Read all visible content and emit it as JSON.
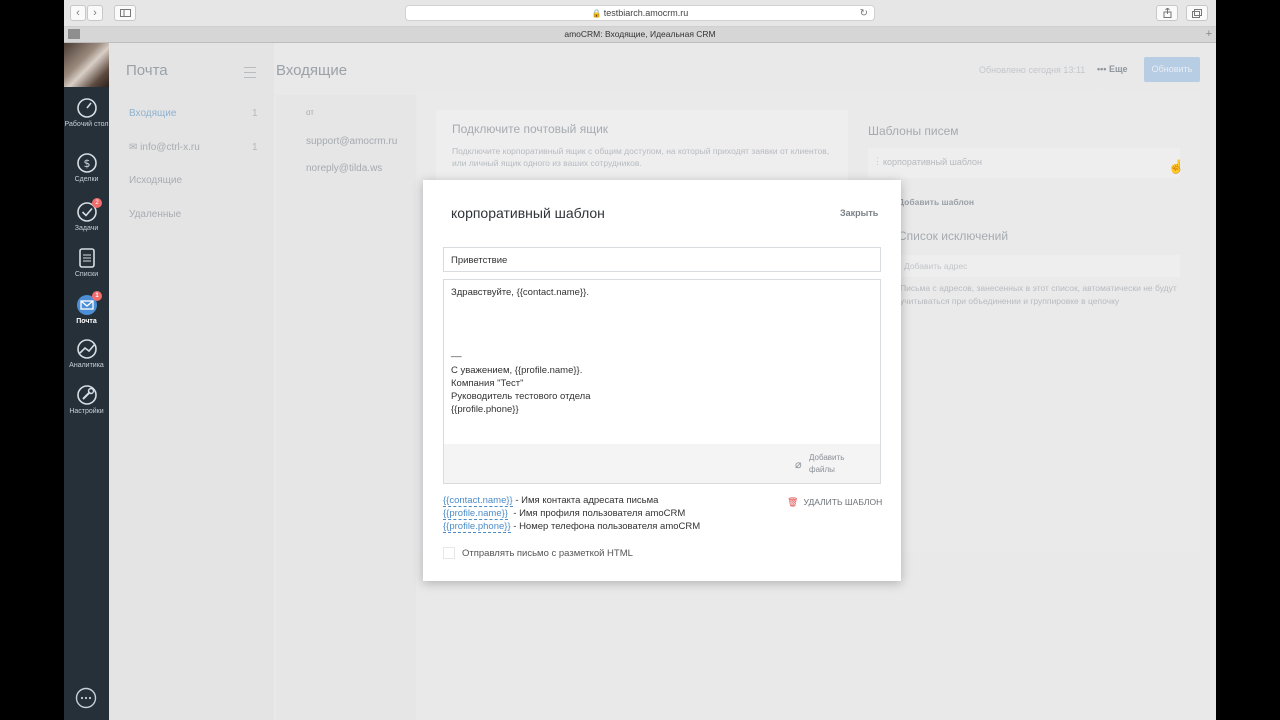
{
  "browser": {
    "url": "testbiarch.amocrm.ru",
    "tab_title": "amoCRM: Входящие, Идеальная CRM"
  },
  "nav": [
    {
      "label": "Рабочий стол",
      "icon": "dashboard-icon"
    },
    {
      "label": "Сделки",
      "icon": "dollar-icon"
    },
    {
      "label": "Задачи",
      "icon": "checkmark-icon",
      "badge": "2"
    },
    {
      "label": "Списки",
      "icon": "list-icon"
    },
    {
      "label": "Почта",
      "icon": "mail-icon",
      "badge": "1",
      "active": true
    },
    {
      "label": "Аналитика",
      "icon": "analytics-icon"
    },
    {
      "label": "Настройки",
      "icon": "settings-icon"
    }
  ],
  "mail": {
    "title": "Почта",
    "inbox_title": "Входящие",
    "folders": [
      {
        "label": "Входящие",
        "count": "1"
      },
      {
        "label": "info@ctrl-x.ru",
        "count": "1"
      },
      {
        "label": "Исходящие",
        "count": ""
      },
      {
        "label": "Удаленные",
        "count": ""
      }
    ],
    "list_header": "от",
    "senders": [
      "support@amocrm.ru",
      "noreply@tilda.ws"
    ],
    "updated": "Обновлено сегодня 13:11",
    "more_label": "Еще",
    "update_button": "Обновить"
  },
  "settings": {
    "connect_title": "Подключите почтовый ящик",
    "connect_desc": "Подключите корпоративный ящик с общим доступом, на который приходят заявки от клиентов, или личный ящик одного из ваших сотрудников.",
    "templates_title": "Шаблоны писем",
    "template_item": "корпоративный шаблон",
    "add_template": "Добавить шаблон",
    "exclusions_title": "Список исключений",
    "exclusions_placeholder": "Добавить адрес",
    "exclusions_desc": "Письма с адресов, занесенных в этот список, автоматически не будут учитываться при объединении и группировке в цепочку"
  },
  "modal": {
    "title": "корпоративный шаблон",
    "close": "Закрыть",
    "subject": "Приветствие",
    "body_lines": [
      "Здравствуйте, {{contact.name}}.",
      "__",
      "С уважением, {{profile.name}}.",
      "Компания \"Тест\"",
      "Руководитель тестового отдела",
      "{{profile.phone}}"
    ],
    "attach": "Добавить файлы",
    "variables": [
      {
        "var": "{{contact.name}}",
        "desc": " - Имя контакта адресата письма"
      },
      {
        "var": "{{profile.name}}",
        "desc": "  - Имя профиля пользователя amoCRM"
      },
      {
        "var": "{{profile.phone}}",
        "desc": " - Номер телефона пользователя amoCRM"
      }
    ],
    "delete": "УДАЛИТЬ ШАБЛОН",
    "html_checkbox": "Отправлять письмо с разметкой HTML"
  }
}
